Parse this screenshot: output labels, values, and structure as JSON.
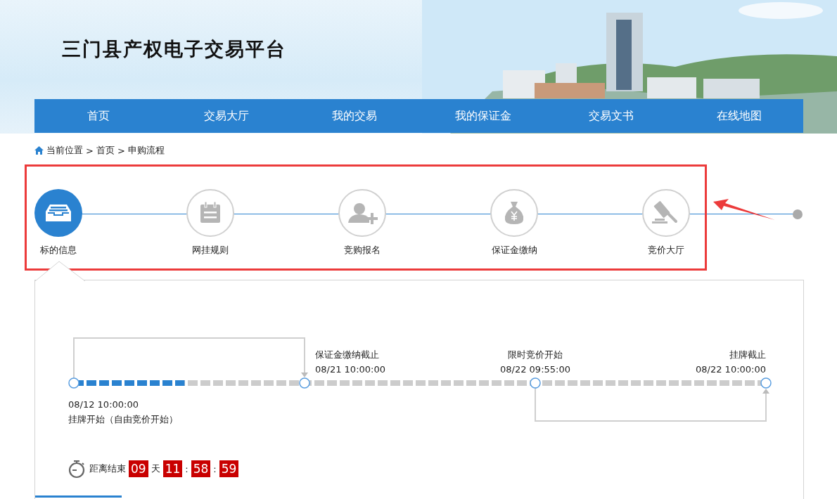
{
  "site_title": "三门县产权电子交易平台",
  "nav": [
    {
      "label": "首页"
    },
    {
      "label": "交易大厅"
    },
    {
      "label": "我的交易"
    },
    {
      "label": "我的保证金"
    },
    {
      "label": "交易文书"
    },
    {
      "label": "在线地图"
    }
  ],
  "breadcrumb": {
    "label": "当前位置",
    "separator": ">",
    "path": [
      "首页",
      "申购流程"
    ]
  },
  "steps": [
    {
      "label": "标的信息",
      "selected": true
    },
    {
      "label": "网挂规则",
      "selected": false
    },
    {
      "label": "竞购报名",
      "selected": false
    },
    {
      "label": "保证金缴纳",
      "selected": false
    },
    {
      "label": "竞价大厅",
      "selected": false
    }
  ],
  "timeline": {
    "level": 0.16,
    "milestones": [
      {
        "title": "挂牌开始（自由竞价开始）",
        "time": "08/12 10:00:00"
      },
      {
        "title": "保证金缴纳截止",
        "time": "08/21 10:00:00"
      },
      {
        "title": "限时竞价开始",
        "time": "08/22 09:55:00"
      },
      {
        "title": "挂牌截止",
        "time": "08/22 10:00:00"
      }
    ]
  },
  "countdown": {
    "label": "距离结束",
    "parts": [
      {
        "kind": "number",
        "text": "09"
      },
      {
        "kind": "unit",
        "text": "天"
      },
      {
        "kind": "number",
        "text": "11"
      },
      {
        "kind": "separator",
        "text": ":"
      },
      {
        "kind": "number",
        "text": "58"
      },
      {
        "kind": "separator",
        "text": ":"
      },
      {
        "kind": "number",
        "text": "59"
      }
    ]
  }
}
